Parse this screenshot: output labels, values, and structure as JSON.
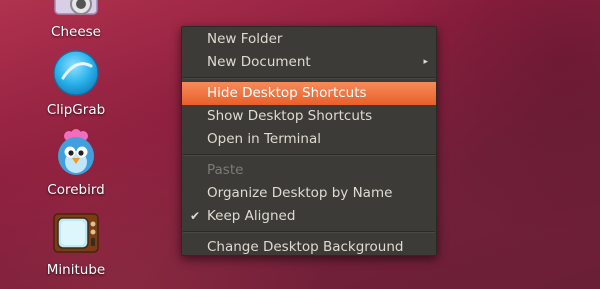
{
  "desktop": {
    "icons": [
      {
        "label": "Cheese",
        "icon": "cheese-webcam-icon"
      },
      {
        "label": "ClipGrab",
        "icon": "clipgrab-icon"
      },
      {
        "label": "Corebird",
        "icon": "corebird-bird-icon"
      },
      {
        "label": "Minitube",
        "icon": "minitube-tv-icon"
      }
    ]
  },
  "context_menu": {
    "items": [
      {
        "label": "New Folder"
      },
      {
        "label": "New Document",
        "submenu": true
      },
      {
        "label": "Hide Desktop Shortcuts",
        "highlighted": true
      },
      {
        "label": "Show Desktop Shortcuts"
      },
      {
        "label": "Open in Terminal"
      },
      {
        "label": "Paste",
        "disabled": true
      },
      {
        "label": "Organize Desktop by Name"
      },
      {
        "label": "Keep Aligned",
        "checked": true
      },
      {
        "label": "Change Desktop Background"
      }
    ],
    "submenu_arrow": "▸",
    "check_mark": "✔"
  },
  "colors": {
    "menu_background": "#3c3b37",
    "menu_text": "#dfdbd2",
    "highlight": "#f07746",
    "disabled_text": "#7e7b75",
    "desktop_background": "#8e1f3f"
  }
}
